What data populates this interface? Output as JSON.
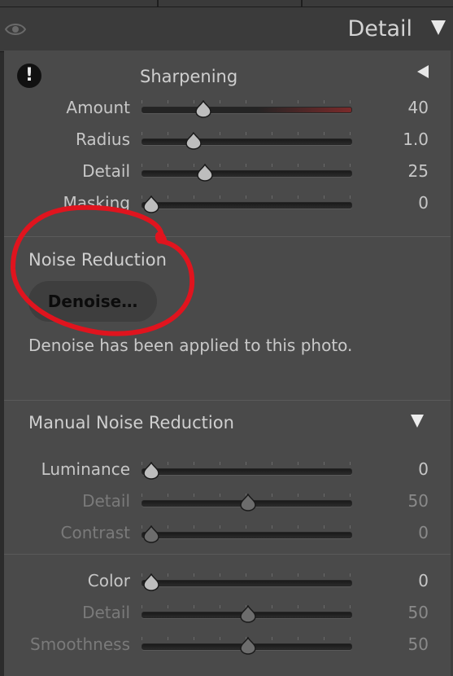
{
  "header": {
    "title": "Detail"
  },
  "sharpening": {
    "title": "Sharpening",
    "sliders": [
      {
        "label": "Amount",
        "value": "40",
        "fraction": 0.27
      },
      {
        "label": "Radius",
        "value": "1.0",
        "fraction": 0.22
      },
      {
        "label": "Detail",
        "value": "25",
        "fraction": 0.28
      },
      {
        "label": "Masking",
        "value": "0",
        "fraction": 0.0
      }
    ]
  },
  "noise_reduction": {
    "title": "Noise Reduction",
    "button_label": "Denoise…",
    "info": "Denoise has been applied to this photo."
  },
  "manual_noise_reduction": {
    "title": "Manual Noise Reduction",
    "luminance_sliders": [
      {
        "label": "Luminance",
        "value": "0",
        "fraction": 0.0,
        "disabled": false
      },
      {
        "label": "Detail",
        "value": "50",
        "fraction": 0.5,
        "disabled": true
      },
      {
        "label": "Contrast",
        "value": "0",
        "fraction": 0.0,
        "disabled": true
      }
    ],
    "color_sliders": [
      {
        "label": "Color",
        "value": "0",
        "fraction": 0.0,
        "disabled": false
      },
      {
        "label": "Detail",
        "value": "50",
        "fraction": 0.5,
        "disabled": true
      },
      {
        "label": "Smoothness",
        "value": "50",
        "fraction": 0.5,
        "disabled": true
      }
    ]
  },
  "colors": {
    "annotation_red": "#e0141e",
    "panel_bg": "#4a4a4a"
  },
  "icons": [
    "eye-icon",
    "collapse-triangle-icon",
    "warning-icon",
    "expand-left-icon",
    "expand-down-icon"
  ]
}
